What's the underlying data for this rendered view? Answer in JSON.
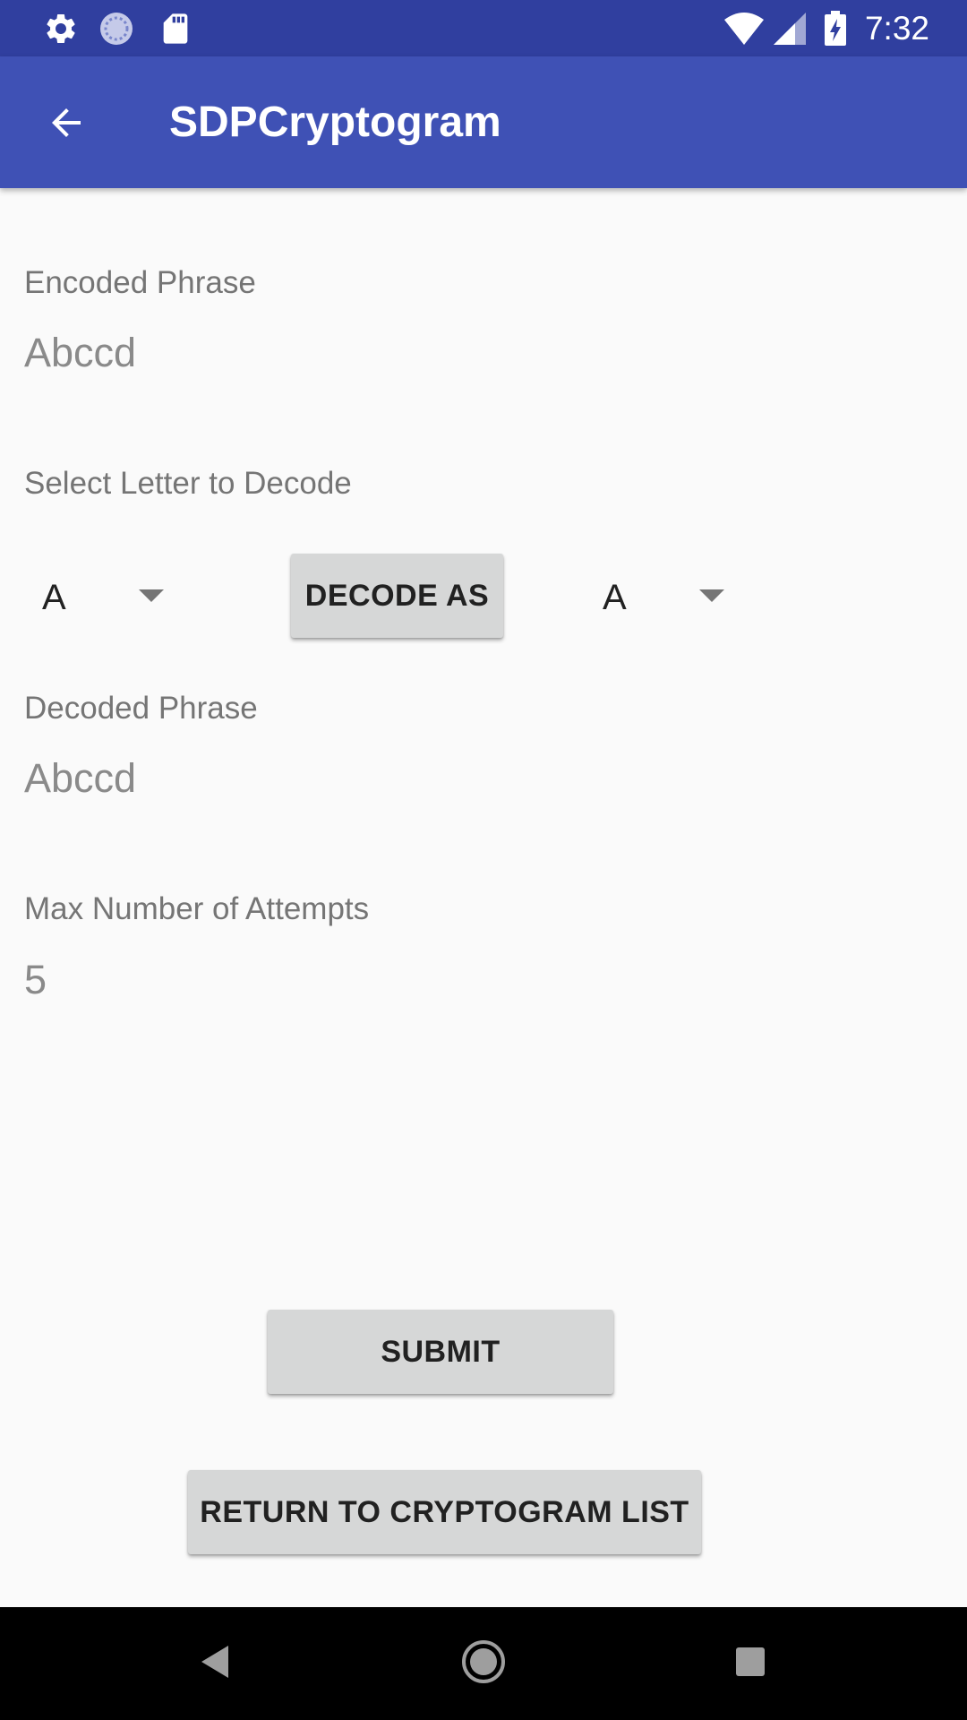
{
  "status_bar": {
    "time": "7:32",
    "icons": [
      "gear-icon",
      "sync-icon",
      "sd-card-icon",
      "wifi-icon",
      "signal-icon",
      "battery-charging-icon"
    ],
    "background": "#303f9f"
  },
  "app_bar": {
    "title": "SDPCryptogram",
    "background": "#3f51b5"
  },
  "encoded": {
    "label": "Encoded Phrase",
    "value": "Abccd"
  },
  "select": {
    "label": "Select Letter to Decode",
    "from_letter": "A",
    "decode_button_label": "DECODE AS",
    "to_letter": "A"
  },
  "decoded": {
    "label": "Decoded Phrase",
    "value": "Abccd"
  },
  "attempts": {
    "label": "Max Number of Attempts",
    "value": "5"
  },
  "actions": {
    "submit_label": "SUBMIT",
    "return_label": "RETURN TO CRYPTOGRAM LIST"
  },
  "nav_bar": {
    "icons": [
      "back-triangle-icon",
      "home-circle-icon",
      "recents-square-icon"
    ]
  }
}
